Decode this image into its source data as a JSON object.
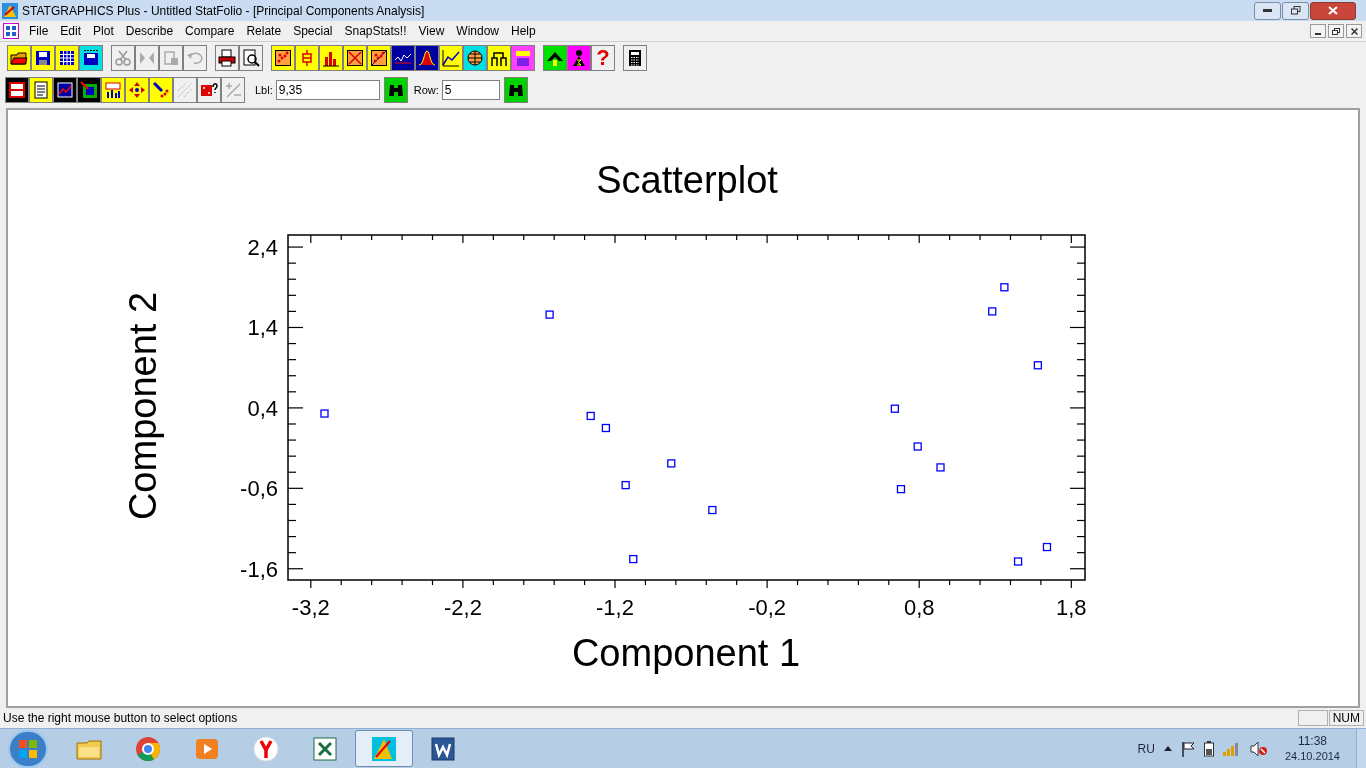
{
  "window": {
    "title": "STATGRAPHICS Plus - Untitled StatFolio - [Principal Components Analysis]"
  },
  "menu": [
    "File",
    "Edit",
    "Plot",
    "Describe",
    "Compare",
    "Relate",
    "Special",
    "SnapStats!!",
    "View",
    "Window",
    "Help"
  ],
  "toolbar": {
    "help_glyph": "?"
  },
  "locator": {
    "label_caption": "Lbl:",
    "label_value": "9,35",
    "row_caption": "Row:",
    "row_value": "5"
  },
  "chart_data": {
    "type": "scatter",
    "title": "Scatterplot",
    "xlabel": "Component 1",
    "ylabel": "Component 2",
    "xlim": [
      -3.35,
      1.89
    ],
    "ylim": [
      -1.74,
      2.55
    ],
    "xticks": [
      {
        "value": -3.2,
        "label": "-3,2"
      },
      {
        "value": -2.2,
        "label": "-2,2"
      },
      {
        "value": -1.2,
        "label": "-1,2"
      },
      {
        "value": -0.2,
        "label": "-0,2"
      },
      {
        "value": 0.8,
        "label": "0,8"
      },
      {
        "value": 1.8,
        "label": "1,8"
      }
    ],
    "yticks": [
      {
        "value": 2.4,
        "label": "2,4"
      },
      {
        "value": 1.4,
        "label": "1,4"
      },
      {
        "value": 0.4,
        "label": "0,4"
      },
      {
        "value": -0.6,
        "label": "-0,6"
      },
      {
        "value": -1.6,
        "label": "-1,6"
      }
    ],
    "series": [
      {
        "color": "#0000ff",
        "x": [
          -3.11,
          -1.63,
          -1.36,
          -1.26,
          -1.13,
          -1.08,
          -0.83,
          -0.56,
          0.64,
          0.68,
          0.79,
          0.94,
          1.28,
          1.36,
          1.58,
          1.45,
          1.64
        ],
        "values": [
          0.33,
          1.56,
          0.3,
          0.15,
          -0.56,
          -1.48,
          -0.29,
          -0.87,
          0.39,
          -0.61,
          -0.08,
          -0.34,
          1.6,
          1.9,
          0.93,
          -1.51,
          -1.33
        ]
      }
    ]
  },
  "status_bar": {
    "message": "Use the right mouse button to select options",
    "indicator": "NUM"
  },
  "taskbar": {
    "language": "RU",
    "time": "11:38",
    "date": "24.10.2014"
  }
}
